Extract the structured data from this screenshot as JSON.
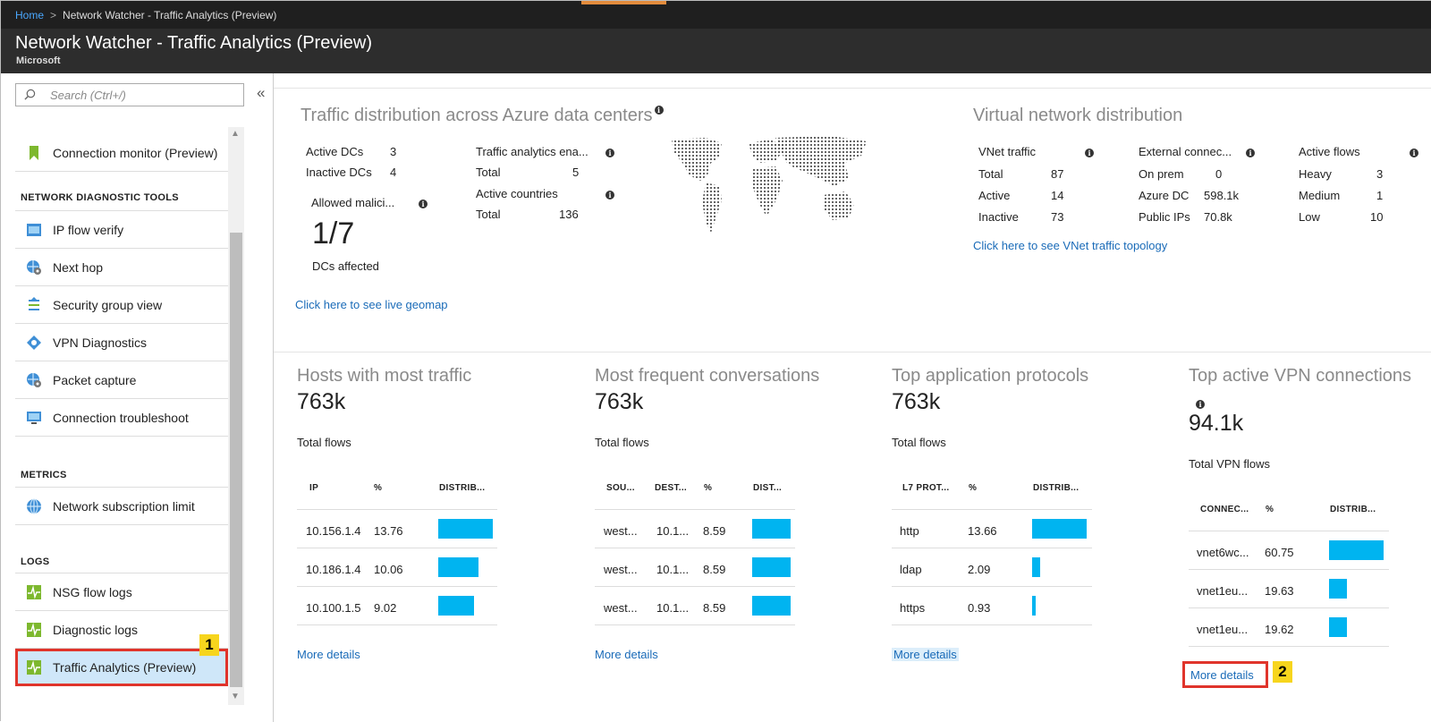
{
  "breadcrumb": {
    "home": "Home",
    "separator": ">",
    "current": "Network Watcher - Traffic Analytics (Preview)"
  },
  "header": {
    "title": "Network Watcher - Traffic Analytics (Preview)",
    "subtitle": "Microsoft"
  },
  "sidebar": {
    "search_placeholder": "Search (Ctrl+/)",
    "collapse_glyph": "«",
    "top_item": "Connection monitor (Preview)",
    "sections": [
      {
        "heading": "NETWORK DIAGNOSTIC TOOLS",
        "items": [
          "IP flow verify",
          "Next hop",
          "Security group view",
          "VPN Diagnostics",
          "Packet capture",
          "Connection troubleshoot"
        ]
      },
      {
        "heading": "METRICS",
        "items": [
          "Network subscription limit"
        ]
      },
      {
        "heading": "LOGS",
        "items": [
          "NSG flow logs",
          "Diagnostic logs",
          "Traffic Analytics (Preview)"
        ]
      }
    ],
    "callout": "1"
  },
  "traffic_distribution": {
    "title": "Traffic distribution across Azure data centers",
    "active_dcs_label": "Active DCs",
    "active_dcs": "3",
    "inactive_dcs_label": "Inactive DCs",
    "inactive_dcs": "4",
    "allowed_label": "Allowed malici...",
    "allowed_value": "1/7",
    "allowed_sub": "DCs affected",
    "ta_enabled_label": "Traffic analytics ena...",
    "ta_total_label": "Total",
    "ta_total": "5",
    "countries_label": "Active countries",
    "countries_total_label": "Total",
    "countries_total": "136",
    "link": "Click here to see live geomap"
  },
  "vnet_distribution": {
    "title": "Virtual network distribution",
    "vnet_label": "VNet traffic",
    "total_label": "Total",
    "total": "87",
    "active_label": "Active",
    "active": "14",
    "inactive_label": "Inactive",
    "inactive": "73",
    "ext_label": "External connec...",
    "onprem_label": "On prem",
    "onprem": "0",
    "azuredc_label": "Azure DC",
    "azuredc": "598.1k",
    "publicip_label": "Public IPs",
    "publicip": "70.8k",
    "flows_label": "Active flows",
    "heavy_label": "Heavy",
    "heavy": "3",
    "medium_label": "Medium",
    "medium": "1",
    "low_label": "Low",
    "low": "10",
    "link": "Click here to see VNet traffic topology"
  },
  "hosts": {
    "title": "Hosts with most traffic",
    "value": "763k",
    "sub": "Total flows",
    "headers": [
      "IP",
      "%",
      "DISTRIB..."
    ],
    "rows": [
      {
        "ip": "10.156.1.4",
        "pct": "13.76",
        "dist": 100
      },
      {
        "ip": "10.186.1.4",
        "pct": "10.06",
        "dist": 73
      },
      {
        "ip": "10.100.1.5",
        "pct": "9.02",
        "dist": 66
      }
    ],
    "more": "More details"
  },
  "conversations": {
    "title": "Most frequent conversations",
    "value": "763k",
    "sub": "Total flows",
    "headers": [
      "SOU...",
      "DEST...",
      "%",
      "DIST..."
    ],
    "rows": [
      {
        "src": "west...",
        "dst": "10.1...",
        "pct": "8.59",
        "dist": 100
      },
      {
        "src": "west...",
        "dst": "10.1...",
        "pct": "8.59",
        "dist": 100
      },
      {
        "src": "west...",
        "dst": "10.1...",
        "pct": "8.59",
        "dist": 100
      }
    ],
    "more": "More details"
  },
  "protocols": {
    "title": "Top application protocols",
    "value": "763k",
    "sub": "Total flows",
    "headers": [
      "L7 PROT...",
      "%",
      "DISTRIB..."
    ],
    "rows": [
      {
        "proto": "http",
        "pct": "13.66",
        "dist": 100
      },
      {
        "proto": "ldap",
        "pct": "2.09",
        "dist": 15
      },
      {
        "proto": "https",
        "pct": "0.93",
        "dist": 7
      }
    ],
    "more": "More details"
  },
  "vpn": {
    "title": "Top active VPN connections",
    "value": "94.1k",
    "sub": "Total VPN flows",
    "headers": [
      "CONNEC...",
      "%",
      "DISTRIB..."
    ],
    "rows": [
      {
        "conn": "vnet6wc...",
        "pct": "60.75",
        "dist": 100
      },
      {
        "conn": "vnet1eu...",
        "pct": "19.63",
        "dist": 32
      },
      {
        "conn": "vnet1eu...",
        "pct": "19.62",
        "dist": 32
      }
    ],
    "more": "More details",
    "callout": "2"
  },
  "colors": {
    "accent_bar": "#00b4f0",
    "link": "#1a6bb8",
    "highlight": "#e0342b",
    "callout": "#f7d51d"
  }
}
